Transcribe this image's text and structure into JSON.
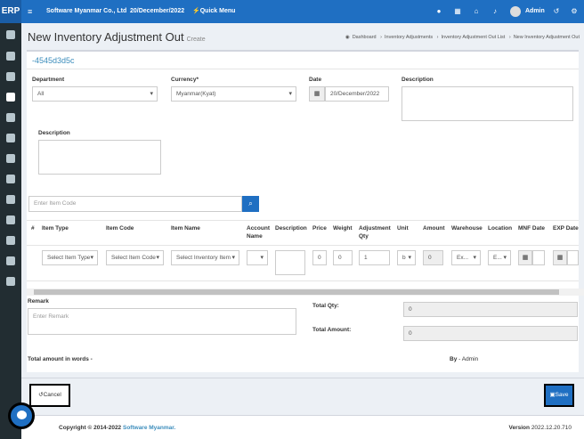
{
  "app": {
    "logo": "ERP",
    "company": "Software Myanmar Co., Ltd",
    "date": "20/December/2022",
    "quick_menu": "Quick Menu",
    "user": "Admin"
  },
  "page": {
    "title": "New Inventory Adjustment Out",
    "subtitle": "Create"
  },
  "breadcrumb": [
    "Dashboard",
    "Inventory Adjustments",
    "Inventory Adjustment Out List",
    "New Inventory Adjustment Out"
  ],
  "doc": {
    "code": "-4545d3d5c"
  },
  "form": {
    "department_label": "Department",
    "department_value": "All",
    "currency_label": "Currency*",
    "currency_value": "Myanmar(Kyat)",
    "date_label": "Date",
    "date_value": "20/December/2022",
    "description_label": "Description",
    "description2_label": "Description",
    "item_code_placeholder": "Enter Item Code"
  },
  "table": {
    "headers": [
      "#",
      "Item Type",
      "Item Code",
      "Item Name",
      "Account Name",
      "Description",
      "Price",
      "Weight",
      "Adjustment Qty",
      "Unit",
      "Amount",
      "Warehouse",
      "Location",
      "MNF Date",
      "EXP Date"
    ],
    "row": {
      "item_type": "Select Item Type",
      "item_code": "Select Item Code",
      "item_name": "Select Inventory Item",
      "price": "0",
      "weight": "0",
      "qty": "1",
      "unit": "b",
      "amount": "0",
      "warehouse": "Ex...",
      "location": "E..."
    }
  },
  "remark": {
    "label": "Remark",
    "placeholder": "Enter Remark"
  },
  "totals": {
    "qty_label": "Total Qty:",
    "qty_value": "0",
    "amount_label": "Total Amount:",
    "amount_value": "0",
    "words_label": "Total amount in words -",
    "by_label": "By",
    "by_value": "- Admin"
  },
  "buttons": {
    "cancel": "Cancel",
    "save": "Save"
  },
  "footer": {
    "copyright": "Copyright © 2014-2022",
    "brand": "Software Myanmar.",
    "version_label": "Version",
    "version": "2022.12.20.710"
  }
}
